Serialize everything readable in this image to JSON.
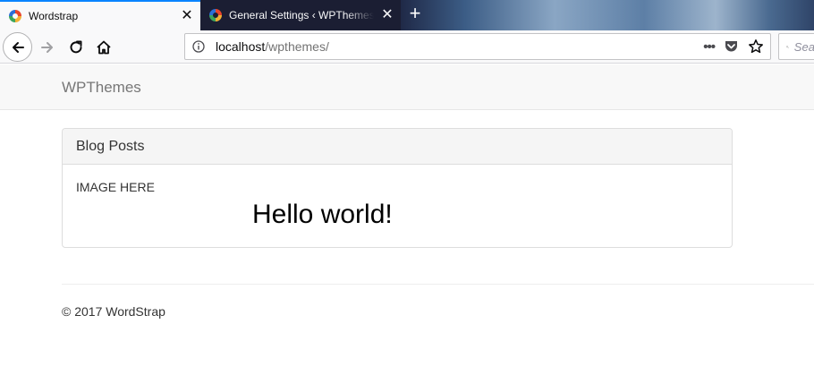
{
  "browser": {
    "tabs": [
      {
        "title": "Wordstrap",
        "active": true
      },
      {
        "title": "General Settings ‹ WPThemes — WordPress",
        "active": false
      }
    ],
    "new_tab_label": "+",
    "close_label": "✕",
    "url": {
      "host": "localhost",
      "path": "/wpthemes/"
    },
    "page_actions_label": "•••",
    "search_placeholder": "Search"
  },
  "site": {
    "brand": "WPThemes",
    "panel_heading": "Blog Posts",
    "image_placeholder": "IMAGE HERE",
    "post_title": "Hello world!",
    "footer": "© 2017 WordStrap"
  },
  "colors": {
    "active_tab_accent": "#0a84ff",
    "inactive_tab_bg": "#1b1e33",
    "navbar_bg": "#f8f8f8",
    "panel_heading_bg": "#f5f5f5"
  },
  "icons": [
    "wordpress-favicon",
    "back-arrow-icon",
    "forward-arrow-icon",
    "reload-icon",
    "home-icon",
    "info-icon",
    "pocket-icon",
    "bookmark-star-icon",
    "search-icon",
    "close-icon",
    "plus-icon"
  ]
}
